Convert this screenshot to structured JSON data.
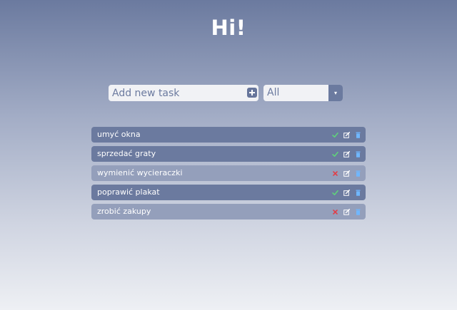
{
  "header": {
    "greeting": "Hi!"
  },
  "form": {
    "placeholder": "Add new task",
    "value": "",
    "add_icon": "plus-square-icon"
  },
  "filter": {
    "selected": "All",
    "arrow": "▾"
  },
  "tasks": [
    {
      "label": "umyć okna",
      "status": "done"
    },
    {
      "label": "sprzedać graty",
      "status": "done"
    },
    {
      "label": "wymienić wycieraczki",
      "status": "undone"
    },
    {
      "label": "poprawić plakat",
      "status": "done"
    },
    {
      "label": "zrobić zakupy",
      "status": "undone"
    }
  ],
  "icons": {
    "done": "checkmark-icon",
    "undone": "cross-icon",
    "edit": "edit-icon",
    "delete": "trash-icon"
  },
  "colors": {
    "primary": "#6b7a9f",
    "done_row": "#6b7a9f",
    "undone_row": "#949fbb",
    "check_green": "#5fd37a",
    "cross_red": "#e0404a",
    "edit_white": "#ffffff",
    "trash_blue": "#70b7ff",
    "input_bg": "#f1f2f5"
  }
}
